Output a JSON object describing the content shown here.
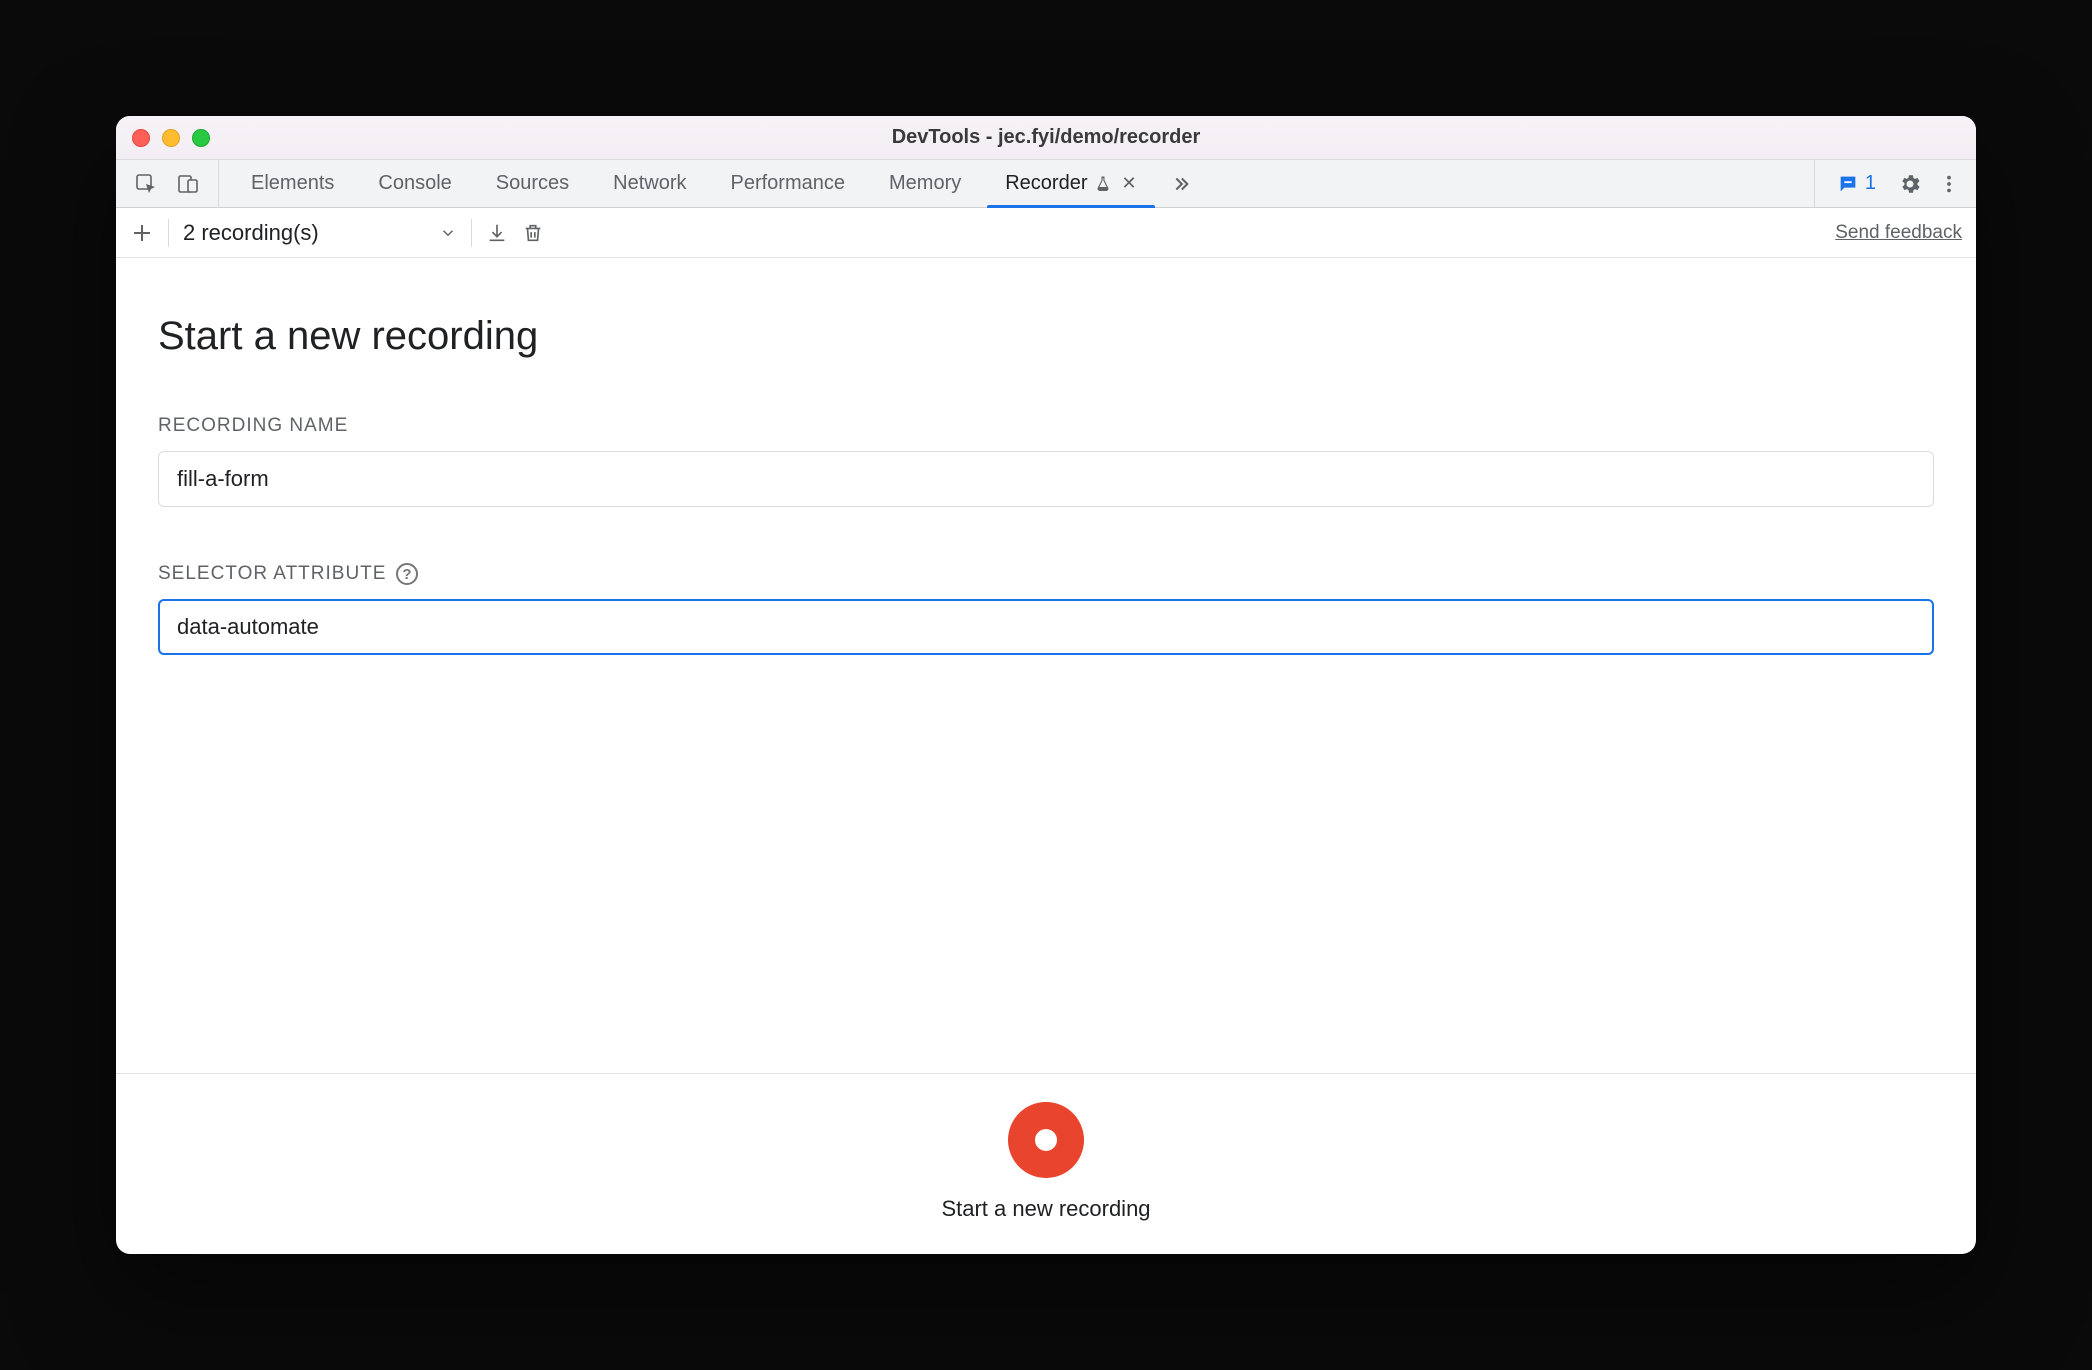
{
  "window": {
    "title": "DevTools - jec.fyi/demo/recorder"
  },
  "tabs": {
    "items": [
      {
        "label": "Elements",
        "active": false
      },
      {
        "label": "Console",
        "active": false
      },
      {
        "label": "Sources",
        "active": false
      },
      {
        "label": "Network",
        "active": false
      },
      {
        "label": "Performance",
        "active": false
      },
      {
        "label": "Memory",
        "active": false
      },
      {
        "label": "Recorder",
        "active": true,
        "experimental": true,
        "closable": true
      }
    ],
    "issues_count": "1"
  },
  "subtoolbar": {
    "recordings_label": "2 recording(s)",
    "feedback": "Send feedback"
  },
  "form": {
    "title": "Start a new recording",
    "name_label": "Recording Name",
    "name_value": "fill-a-form",
    "selector_label": "Selector Attribute",
    "selector_value": "data-automate"
  },
  "bottom": {
    "label": "Start a new recording"
  }
}
